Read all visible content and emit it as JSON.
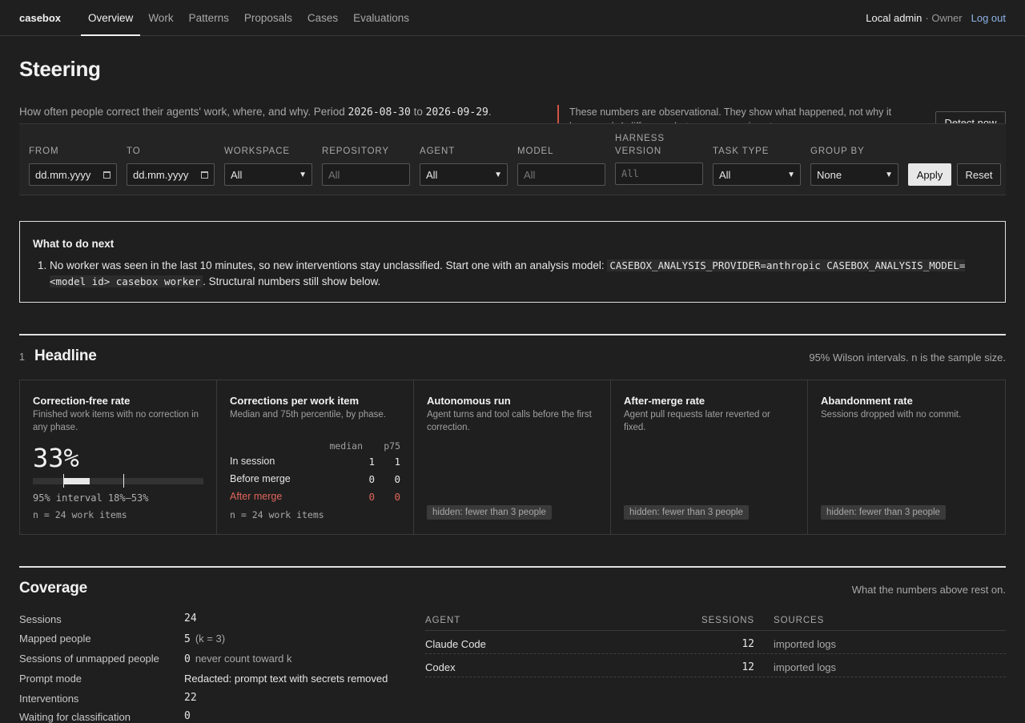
{
  "nav": {
    "brand": "casebox",
    "tabs": [
      {
        "label": "Overview",
        "active": true
      },
      {
        "label": "Work"
      },
      {
        "label": "Patterns"
      },
      {
        "label": "Proposals"
      },
      {
        "label": "Cases"
      },
      {
        "label": "Evaluations"
      }
    ],
    "user_name": "Local admin",
    "user_role": "· Owner",
    "logout": "Log out"
  },
  "header": {
    "title": "Steering",
    "subtitle_prefix": "How often people correct their agents' work, where, and why. Period ",
    "period_from": "2026-08-30",
    "subtitle_to": " to ",
    "period_to": "2026-09-29",
    "subtitle_suffix": ".",
    "note": "These numbers are observational. They show what happened, not why it happened. A difference between groups is not a cause.",
    "detect_button": "Detect now"
  },
  "filters": {
    "from_label": "FROM",
    "from_value": "dd.mm.yyyy",
    "to_label": "TO",
    "to_value": "dd.mm.yyyy",
    "workspace_label": "WORKSPACE",
    "workspace_value": "All",
    "repository_label": "REPOSITORY",
    "repository_placeholder": "All",
    "agent_label": "AGENT",
    "agent_value": "All",
    "model_label": "MODEL",
    "model_placeholder": "All",
    "harness_label": "HARNESS VERSION",
    "harness_placeholder": "All",
    "tasktype_label": "TASK TYPE",
    "tasktype_value": "All",
    "groupby_label": "GROUP BY",
    "groupby_value": "None",
    "apply": "Apply",
    "reset": "Reset"
  },
  "todo": {
    "title": "What to do next",
    "item_num": "1.",
    "item_text": "No worker was seen in the last 10 minutes, so new interventions stay unclassified. Start one with an analysis model:",
    "item_code": "CASEBOX_ANALYSIS_PROVIDER=anthropic CASEBOX_ANALYSIS_MODEL=<model id> casebox worker",
    "item_suffix": ". Structural numbers still show below."
  },
  "headline": {
    "num": "1",
    "title": "Headline",
    "note": "95% Wilson intervals. n is the sample size.",
    "cards": {
      "correction_free": {
        "title": "Correction-free rate",
        "desc": "Finished work items with no correction in any phase.",
        "value": "33%",
        "rate": 0.33,
        "ci_low": 0.18,
        "ci_high": 0.53,
        "interval": "95% interval 18%–53%",
        "n": "n = 24 work items"
      },
      "corrections": {
        "title": "Corrections per work item",
        "desc": "Median and 75th percentile, by phase.",
        "col_median": "median",
        "col_p75": "p75",
        "rows": [
          {
            "label": "In session",
            "median": "1",
            "p75": "1"
          },
          {
            "label": "Before merge",
            "median": "0",
            "p75": "0"
          },
          {
            "label": "After merge",
            "median": "0",
            "p75": "0"
          }
        ],
        "n": "n = 24 work items"
      },
      "autonomous": {
        "title": "Autonomous run",
        "desc": "Agent turns and tool calls before the first correction.",
        "badge": "hidden: fewer than 3 people"
      },
      "after_merge": {
        "title": "After-merge rate",
        "desc": "Agent pull requests later reverted or fixed.",
        "badge": "hidden: fewer than 3 people"
      },
      "abandonment": {
        "title": "Abandonment rate",
        "desc": "Sessions dropped with no commit.",
        "badge": "hidden: fewer than 3 people"
      }
    }
  },
  "coverage": {
    "title": "Coverage",
    "note": "What the numbers above rest on.",
    "rows": [
      {
        "label": "Sessions",
        "value": "24",
        "extra": ""
      },
      {
        "label": "Mapped people",
        "value": "5",
        "extra": "(k = 3)"
      },
      {
        "label": "Sessions of unmapped people",
        "value": "0",
        "extra": "never count toward k"
      },
      {
        "label": "Prompt mode",
        "value": "Redacted: prompt text with secrets removed",
        "extra": ""
      },
      {
        "label": "Interventions",
        "value": "22",
        "extra": ""
      },
      {
        "label": "Waiting for classification",
        "value": "0",
        "extra": ""
      }
    ],
    "agents_head": {
      "agent": "AGENT",
      "sessions": "SESSIONS",
      "sources": "SOURCES"
    },
    "agents": [
      {
        "agent": "Claude Code",
        "sessions": "12",
        "sources": "imported logs"
      },
      {
        "agent": "Codex",
        "sessions": "12",
        "sources": "imported logs"
      }
    ]
  }
}
